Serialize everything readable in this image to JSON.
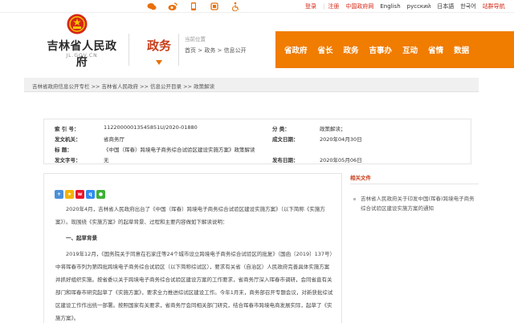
{
  "topbar": {
    "icons": [
      "wechat-icon",
      "weibo-icon",
      "mobile-icon",
      "app-icon",
      "accessibility-icon"
    ],
    "login": "登录",
    "register": "注册",
    "china_gov": "中国政府网",
    "lang_en": "English",
    "lang_ru": "русский",
    "lang_ja": "日本語",
    "lang_ko": "한국어",
    "elder_mode": "站群导航"
  },
  "header": {
    "site_name": "吉林省人民政府",
    "site_domain": "JL.GOV.CN",
    "section": "政务",
    "location_label": "当前位置",
    "location_path": "首页 > 政务 > 信息公开"
  },
  "nav": {
    "items": [
      "省政府",
      "省长",
      "政务",
      "吉事办",
      "互动",
      "省情",
      "数据"
    ]
  },
  "breadcrumb": "吉林省政府信息公开专栏 >> 吉林省人民政府 >> 信息公开目录 >> 政策解读",
  "meta": {
    "index_label": "索 引 号：",
    "index_value": "11220000013545851U/2020-01880",
    "category_label": "分 类：",
    "category_value": "政策解读；",
    "issuer_label": "发文机关：",
    "issuer_value": "省商务厅",
    "date_label": "成文日期：",
    "date_value": "2020年04月30日",
    "title_label": "标 题：",
    "title_value": "《中国（珲春）跨境电子商务综合试验区建设实施方案》政策解读",
    "docno_label": "发文字号：",
    "docno_value": "无",
    "pubdate_label": "发布日期：",
    "pubdate_value": "2020年05月06日"
  },
  "article": {
    "p1": "2020年4月，吉林省人民政府出台了《中国（珲春）跨境电子商务综合试验区建设实施方案》（以下简称《实施方案》）。现围绕《实施方案》的起草背景、过程和主要内容做如下解读说明：",
    "subhead1": "一、起草背景",
    "p2": "2019年12月，《国务院关于同意在石家庄等24个城市设立跨境电子商务综合试验区的批复》（国函〔2019〕137号）中将珲春市列为第四批跨境电子商务综合试验区（以下简称综试区），要求有关省（自治区）人民政府完善具体实施方案并抓好组织实施。按省委以关于跨境电子商务综合试验区建设方案的工作要求，省商务厅深入珲春市调研，会同省直有关部门和珲春市研究起草了《实施方案》，要求全力推进综试区建设工作。今年1月末，商务部召开专题会议，对新获批综试区建设工作作出统一部署。按照国家有关要求，省商务厅会同相关部门研究，结合珲春市跨境电商发展实际，起草了《实施方案》。"
  },
  "related": {
    "title": "相关文件",
    "items": [
      "吉林省人民政府关于印发中国(珲春)跨境电子商务综合试验区建设实施方案的通知"
    ]
  },
  "colors": {
    "accent": "#f07c00",
    "brand_red": "#c73d1a"
  }
}
